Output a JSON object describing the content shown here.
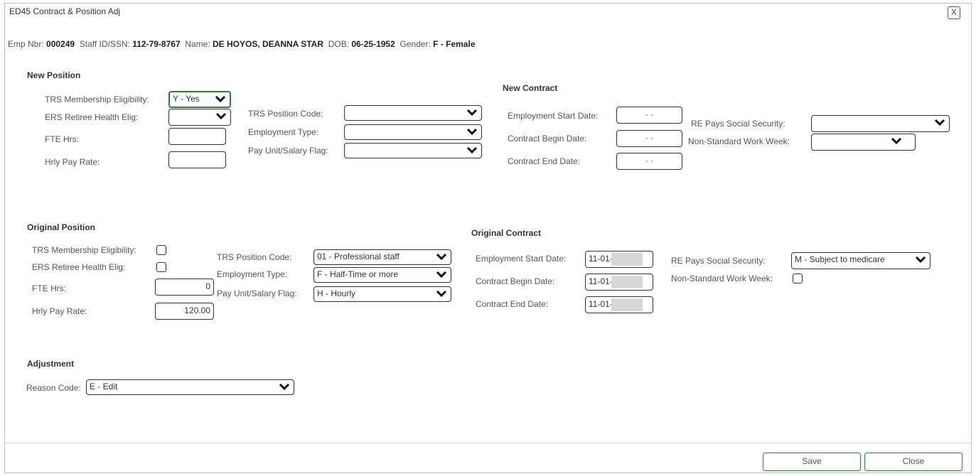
{
  "dialog": {
    "title": "ED45 Contract & Position Adj",
    "close_glyph": "X"
  },
  "employee": {
    "emp_nbr_label": "Emp Nbr:",
    "emp_nbr": "000249",
    "staff_id_label": "Staff ID/SSN:",
    "staff_id": "112-79-8767",
    "name_label": "Name:",
    "name": "DE HOYOS, DEANNA STAR",
    "dob_label": "DOB:",
    "dob": "06-25-1952",
    "gender_label": "Gender:",
    "gender": "F - Female"
  },
  "new_position": {
    "heading": "New Position",
    "trs_elig_label": "TRS Membership Eligibility:",
    "trs_elig_value": "Y - Yes",
    "ers_label": "ERS Retiree Health Elig:",
    "ers_value": "",
    "fte_label": "FTE Hrs:",
    "fte_value": "",
    "rate_label": "Hrly Pay Rate:",
    "rate_value": "",
    "trs_code_label": "TRS Position Code:",
    "trs_code_value": "",
    "emp_type_label": "Employment Type:",
    "emp_type_value": "",
    "pay_unit_label": "Pay Unit/Salary Flag:",
    "pay_unit_value": ""
  },
  "new_contract": {
    "heading": "New Contract",
    "start_label": "Employment Start Date:",
    "start_value": "- -",
    "begin_label": "Contract Begin Date:",
    "begin_value": "- -",
    "end_label": "Contract End Date:",
    "end_value": "- -",
    "ss_label": "RE Pays Social Security:",
    "ss_value": "",
    "nsww_label": "Non-Standard Work Week:",
    "nsww_value": ""
  },
  "original_position": {
    "heading": "Original Position",
    "trs_elig_label": "TRS Membership Eligibility:",
    "trs_elig_checked": false,
    "ers_label": "ERS Retiree Health Elig:",
    "ers_checked": false,
    "fte_label": "FTE Hrs:",
    "fte_value": "0",
    "rate_label": "Hrly Pay Rate:",
    "rate_value": "120.00",
    "trs_code_label": "TRS Position Code:",
    "trs_code_value": "01 - Professional staff",
    "emp_type_label": "Employment Type:",
    "emp_type_value": "F - Half-Time or more",
    "pay_unit_label": "Pay Unit/Salary Flag:",
    "pay_unit_value": "H - Hourly"
  },
  "original_contract": {
    "heading": "Original Contract",
    "start_label": "Employment Start Date:",
    "start_value": "11-01-",
    "begin_label": "Contract Begin Date:",
    "begin_value": "11-01-",
    "end_label": "Contract End Date:",
    "end_value": "11-01-",
    "ss_label": "RE Pays Social Security:",
    "ss_value": "M - Subject to medicare",
    "nsww_label": "Non-Standard Work Week:",
    "nsww_checked": false
  },
  "adjustment": {
    "heading": "Adjustment",
    "reason_label": "Reason Code:",
    "reason_value": "E - Edit"
  },
  "footer": {
    "save_label": "Save",
    "close_label": "Close"
  },
  "colors": {
    "accent_green": "#2e7d32",
    "text": "#333333",
    "border": "#bfbfbf"
  }
}
